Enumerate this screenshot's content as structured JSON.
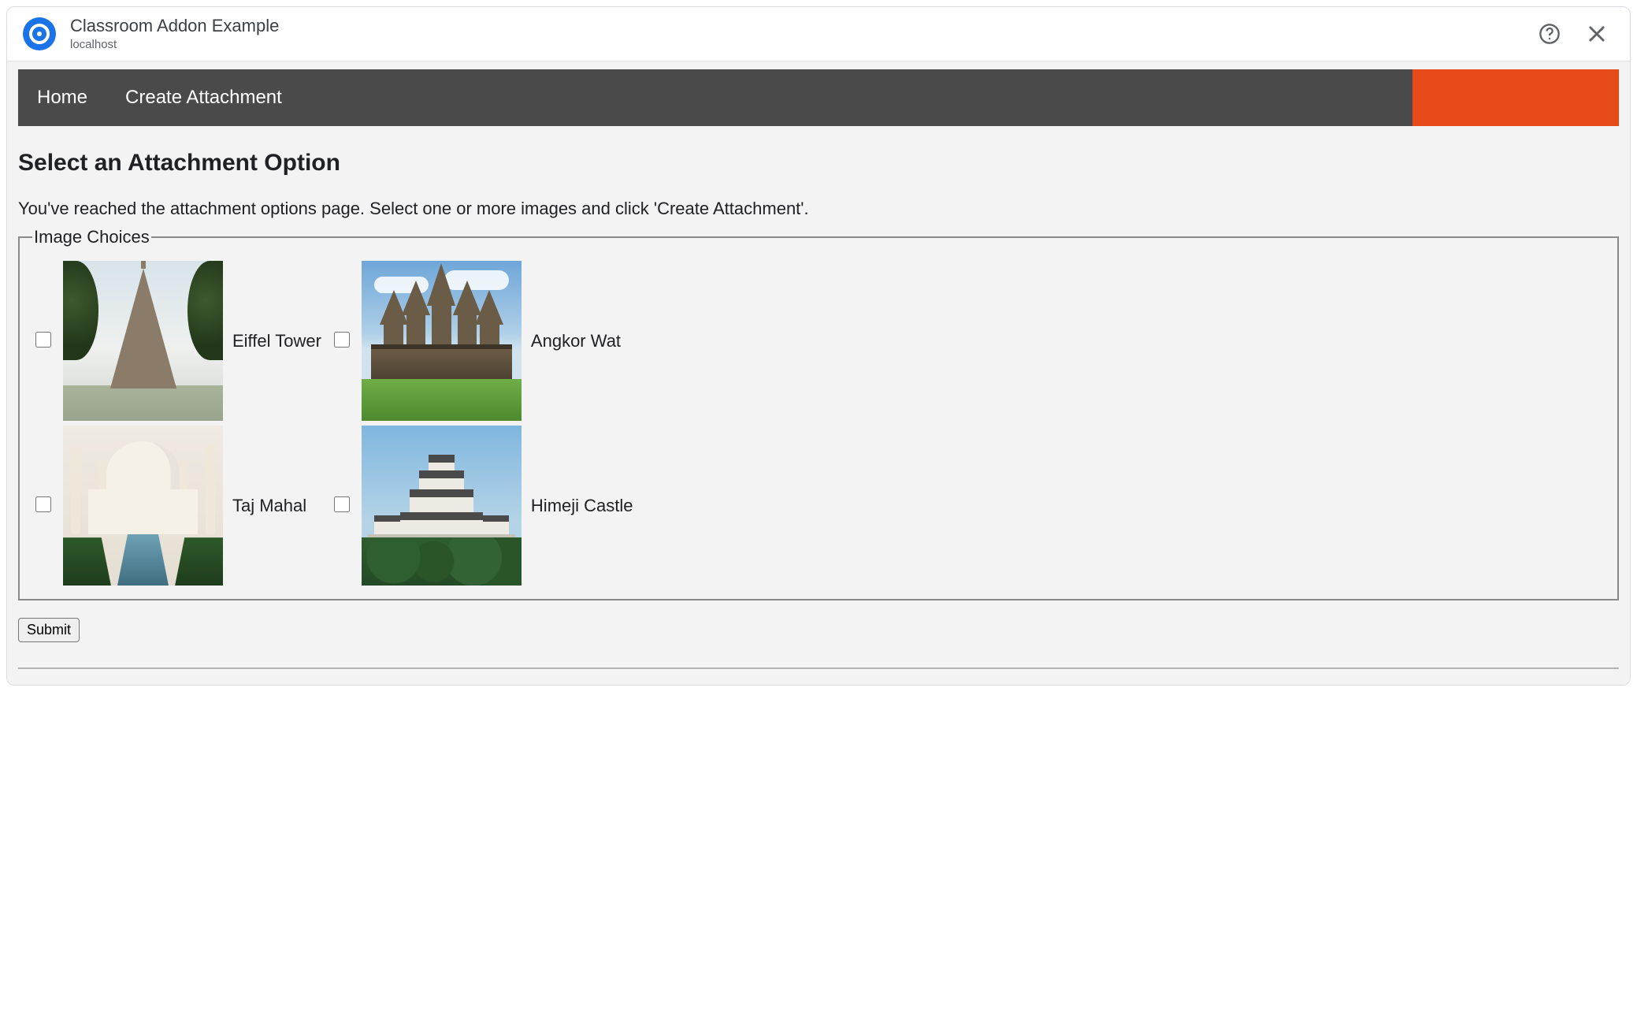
{
  "header": {
    "title": "Classroom Addon Example",
    "subtitle": "localhost"
  },
  "nav": {
    "home": "Home",
    "create": "Create Attachment"
  },
  "page": {
    "heading": "Select an Attachment Option",
    "description": "You've reached the attachment options page. Select one or more images and click 'Create Attachment'.",
    "legend": "Image Choices"
  },
  "images": {
    "item0": {
      "label": "Eiffel Tower",
      "checked": false
    },
    "item1": {
      "label": "Angkor Wat",
      "checked": false
    },
    "item2": {
      "label": "Taj Mahal",
      "checked": false
    },
    "item3": {
      "label": "Himeji Castle",
      "checked": false
    }
  },
  "actions": {
    "submit": "Submit"
  }
}
